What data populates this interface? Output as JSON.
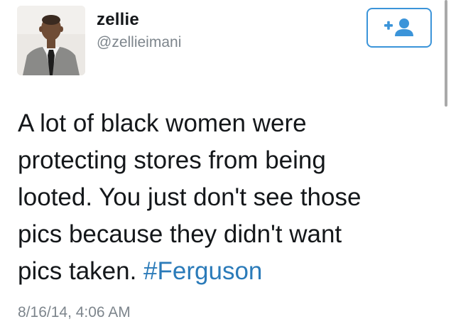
{
  "tweet": {
    "display_name": "zellie",
    "handle": "@zellieimani",
    "text_lines": [
      "A lot of black women were",
      "protecting stores from being",
      "looted. You just don't see those",
      "pics because they didn't want",
      "pics taken. "
    ],
    "hashtag": "#Ferguson",
    "timestamp": "8/16/14, 4:06 AM"
  },
  "follow_button": {
    "icon": "add-user-icon",
    "plus_glyph": "+"
  },
  "colors": {
    "accent": "#3b94d9",
    "hashtag": "#2b7bb9",
    "text": "#14171a",
    "secondary_text": "#7d858c"
  }
}
